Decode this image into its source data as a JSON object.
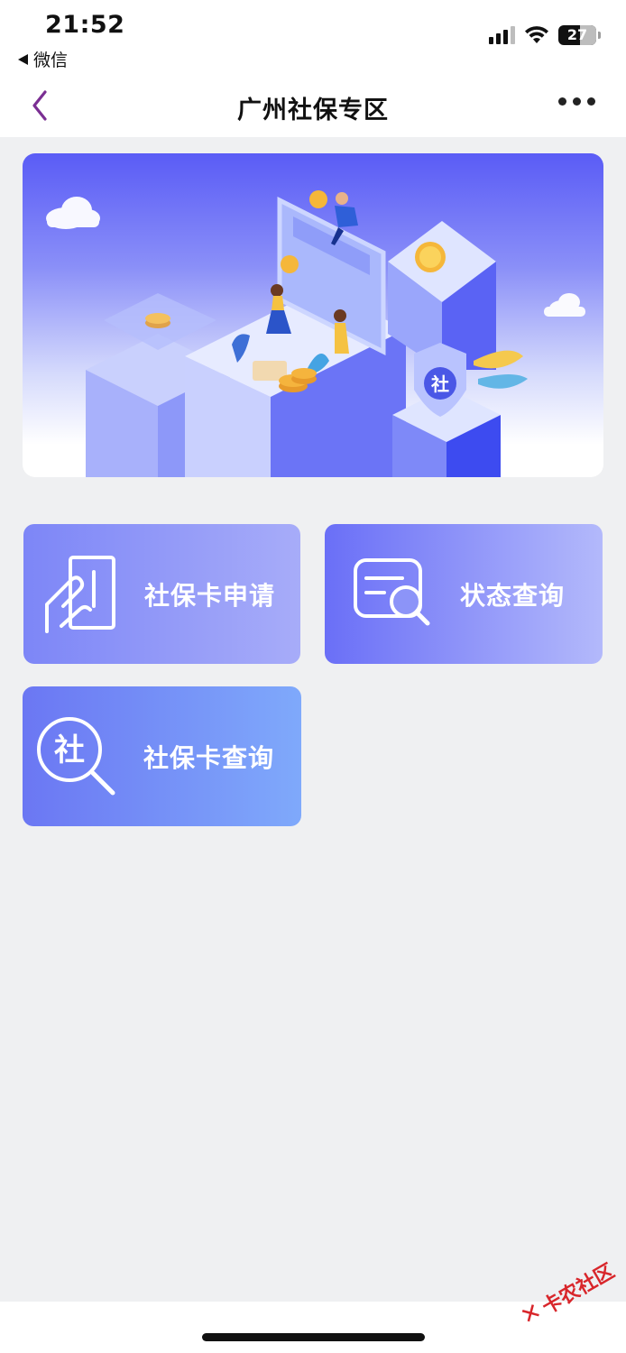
{
  "status_bar": {
    "time": "21:52",
    "back_app": "微信",
    "battery": "27"
  },
  "header": {
    "title": "广州社保专区",
    "back_icon": "chevron-left-icon",
    "more_icon": "more-dots-icon",
    "accent_color": "#7b2f93"
  },
  "banner": {
    "illustration": "social-security-isometric-banner",
    "badge_text": "社"
  },
  "services": [
    {
      "label": "社保卡申请",
      "icon": "hand-card-icon"
    },
    {
      "label": "状态查询",
      "icon": "document-search-icon"
    },
    {
      "label": "社保卡查询",
      "icon": "she-magnifier-icon",
      "icon_text": "社"
    }
  ],
  "watermark": {
    "text": "卡农社区"
  }
}
